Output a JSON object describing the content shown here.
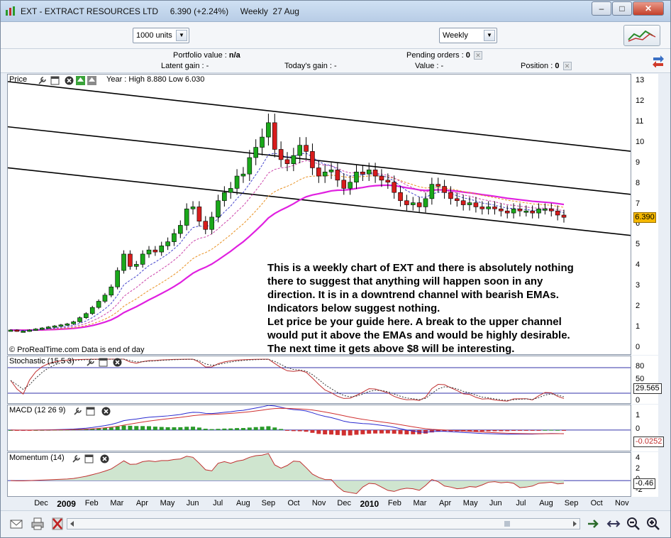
{
  "window": {
    "title": "EXT - EXTRACT RESOURCES LTD     6.390 (+2.24%)     Weekly  27 Aug",
    "minimize": "–",
    "maximize": "□",
    "close": "✕"
  },
  "toolbar": {
    "units_value": "1000 units",
    "period_value": "Weekly"
  },
  "info": {
    "portfolio_label": "Portfolio value :",
    "portfolio_value": "n/a",
    "pending_label": "Pending orders :",
    "pending_value": "0",
    "latent_label": "Latent gain :",
    "latent_value": "-",
    "today_label": "Today's gain :",
    "today_value": "-",
    "value_label": "Value :",
    "value_value": "-",
    "position_label": "Position :",
    "position_value": "0"
  },
  "price_panel": {
    "title": "Price",
    "range_text": "Year : High 8.880 Low 6.030",
    "credit": "© ProRealTime.com  Data is end of day",
    "last_price": "6.390",
    "ticks": [
      "13",
      "12",
      "11",
      "10",
      "9",
      "8",
      "7",
      "6",
      "5",
      "4",
      "3",
      "2",
      "1",
      "0"
    ]
  },
  "annotation": [
    "This is a weekly chart of EXT and there is absolutely nothing",
    "there to suggest that anything will happen soon in any",
    "direction. It is in a downtrend channel with bearish EMAs.",
    "Indicators below suggest nothing.",
    "Let price be your guide here. A break to the upper channel",
    "would put it above the EMAs and would be highly desirable.",
    "The next time it gets above $8 will be interesting."
  ],
  "stochastic_panel": {
    "title": "Stochastic (15 5 3)",
    "ticks": [
      "80",
      "50",
      "20",
      "0"
    ],
    "value": "29.565"
  },
  "macd_panel": {
    "title": "MACD (12 26 9)",
    "ticks": [
      "1",
      "0",
      "-1"
    ],
    "value": "-0.0252"
  },
  "momentum_panel": {
    "title": "Momentum (14)",
    "ticks": [
      "4",
      "2",
      "0",
      "-2"
    ],
    "value": "-0.46"
  },
  "xaxis": {
    "labels": [
      "Dec",
      "2009",
      "Feb",
      "Mar",
      "Apr",
      "May",
      "Jun",
      "Jul",
      "Aug",
      "Sep",
      "Oct",
      "Nov",
      "Dec",
      "2010",
      "Feb",
      "Mar",
      "Apr",
      "May",
      "Jun",
      "Jul",
      "Aug",
      "Sep",
      "Oct",
      "Nov"
    ]
  },
  "chart_data": {
    "type": "candlestick",
    "title": "EXT - EXTRACT RESOURCES LTD",
    "interval": "Weekly",
    "ylim": [
      0,
      13
    ],
    "year_high": 8.88,
    "year_low": 6.03,
    "close_series": [
      0.9,
      0.85,
      0.85,
      0.9,
      0.95,
      1.0,
      1.05,
      1.1,
      1.15,
      1.2,
      1.3,
      1.5,
      1.7,
      2.0,
      2.3,
      2.6,
      3.0,
      3.8,
      4.6,
      4.0,
      4.1,
      4.6,
      4.8,
      4.7,
      5.0,
      5.2,
      5.6,
      6.0,
      6.8,
      6.9,
      6.2,
      5.8,
      6.4,
      7.2,
      7.6,
      7.8,
      8.4,
      8.5,
      9.3,
      9.8,
      10.3,
      11.0,
      9.7,
      9.2,
      9.0,
      9.4,
      9.9,
      9.6,
      8.8,
      8.4,
      8.6,
      8.7,
      8.2,
      7.8,
      8.1,
      8.6,
      8.5,
      8.7,
      8.4,
      8.2,
      8.1,
      7.6,
      7.2,
      7.0,
      7.1,
      6.9,
      7.3,
      8.0,
      7.9,
      7.6,
      7.3,
      7.2,
      7.0,
      7.1,
      6.9,
      6.8,
      6.9,
      6.8,
      6.7,
      6.6,
      6.8,
      6.7,
      6.7,
      6.6,
      6.8,
      6.8,
      6.7,
      6.5,
      6.39
    ],
    "channel": [
      {
        "name": "upper",
        "from": [
          0,
          13.0
        ],
        "to": [
          88,
          9.6
        ]
      },
      {
        "name": "middle",
        "from": [
          0,
          10.8
        ],
        "to": [
          88,
          7.5
        ]
      },
      {
        "name": "lower",
        "from": [
          0,
          8.8
        ],
        "to": [
          88,
          5.5
        ]
      }
    ]
  }
}
